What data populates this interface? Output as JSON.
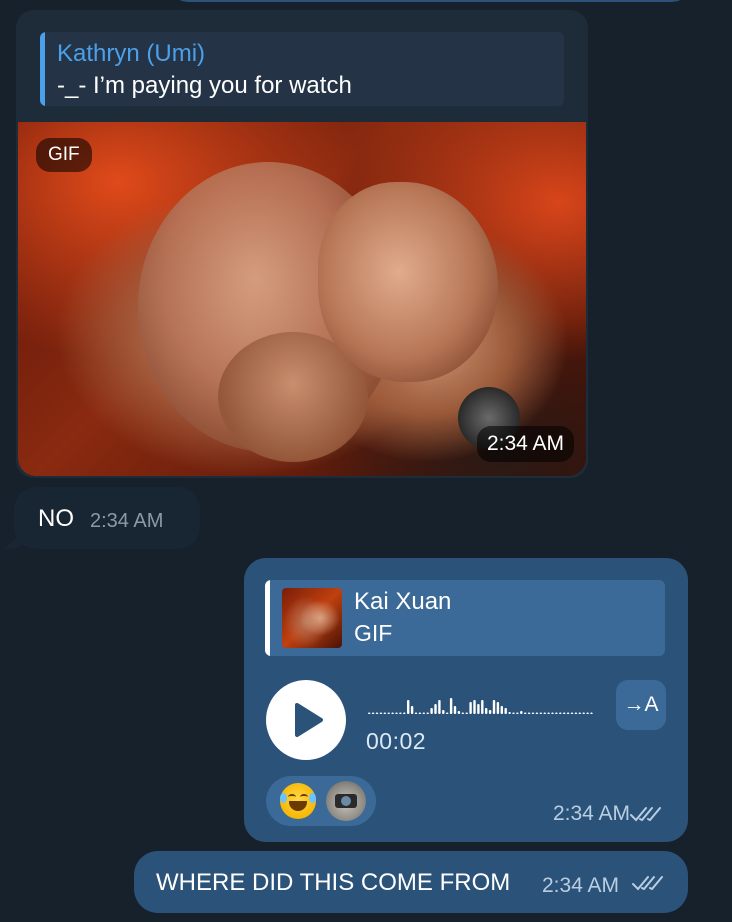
{
  "colors": {
    "background": "#17212b",
    "incoming_bubble": "#182533",
    "outgoing_bubble": "#2b5278",
    "accent_name": "#4ba0ea"
  },
  "gif_message": {
    "reply": {
      "author": "Kathryn (Umi)",
      "text": "-_- I’m paying you for watch"
    },
    "media_badge": "GIF",
    "time": "2:34 AM"
  },
  "no_message": {
    "text": "NO",
    "time": "2:34 AM"
  },
  "voice_message": {
    "reply": {
      "author": "Kai Xuan",
      "text": "GIF"
    },
    "duration": "00:02",
    "transcribe_label": "→A",
    "reactions": [
      "rolling-on-floor-laughing-emoji",
      "user-avatar"
    ],
    "time": "2:34 AM",
    "status": "read"
  },
  "where_message": {
    "text": "WHERE DID THIS COME FROM",
    "time": "2:34 AM",
    "status": "read"
  }
}
